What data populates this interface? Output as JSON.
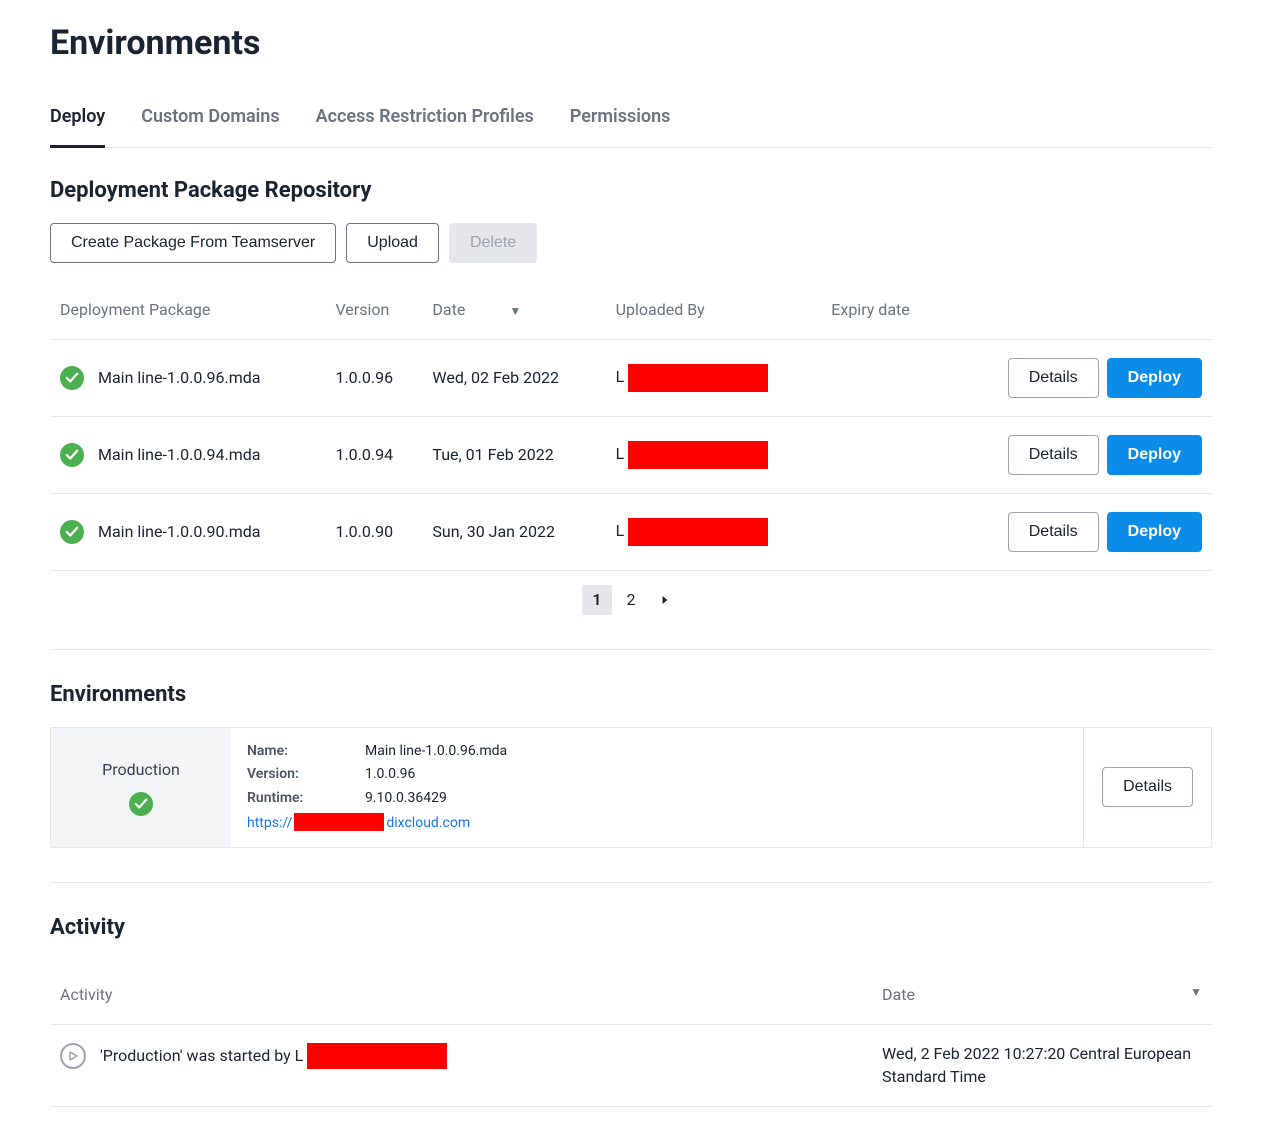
{
  "page_title": "Environments",
  "tabs": [
    {
      "label": "Deploy",
      "active": true
    },
    {
      "label": "Custom Domains",
      "active": false
    },
    {
      "label": "Access Restriction Profiles",
      "active": false
    },
    {
      "label": "Permissions",
      "active": false
    }
  ],
  "repo": {
    "title": "Deployment Package Repository",
    "buttons": {
      "create": "Create Package From Teamserver",
      "upload": "Upload",
      "delete": "Delete"
    },
    "columns": {
      "package": "Deployment Package",
      "version": "Version",
      "date": "Date",
      "uploaded_by": "Uploaded By",
      "expiry": "Expiry date"
    },
    "rows": [
      {
        "name": "Main line-1.0.0.96.mda",
        "version": "1.0.0.96",
        "date": "Wed, 02 Feb 2022",
        "uploaded_prefix": "L"
      },
      {
        "name": "Main line-1.0.0.94.mda",
        "version": "1.0.0.94",
        "date": "Tue, 01 Feb 2022",
        "uploaded_prefix": "L"
      },
      {
        "name": "Main line-1.0.0.90.mda",
        "version": "1.0.0.90",
        "date": "Sun, 30 Jan 2022",
        "uploaded_prefix": "L"
      }
    ],
    "row_buttons": {
      "details": "Details",
      "deploy": "Deploy"
    },
    "pages": [
      "1",
      "2"
    ]
  },
  "envs": {
    "title": "Environments",
    "card": {
      "label": "Production",
      "name_key": "Name:",
      "name_val": "Main line-1.0.0.96.mda",
      "version_key": "Version:",
      "version_val": "1.0.0.96",
      "runtime_key": "Runtime:",
      "runtime_val": "9.10.0.36429",
      "url_prefix": "https://",
      "url_suffix": "dixcloud.com",
      "details": "Details"
    }
  },
  "activity": {
    "title": "Activity",
    "columns": {
      "activity": "Activity",
      "date": "Date"
    },
    "row": {
      "prefix": "'Production' was started by L",
      "date": "Wed, 2 Feb 2022 10:27:20 Central European Standard Time"
    }
  }
}
